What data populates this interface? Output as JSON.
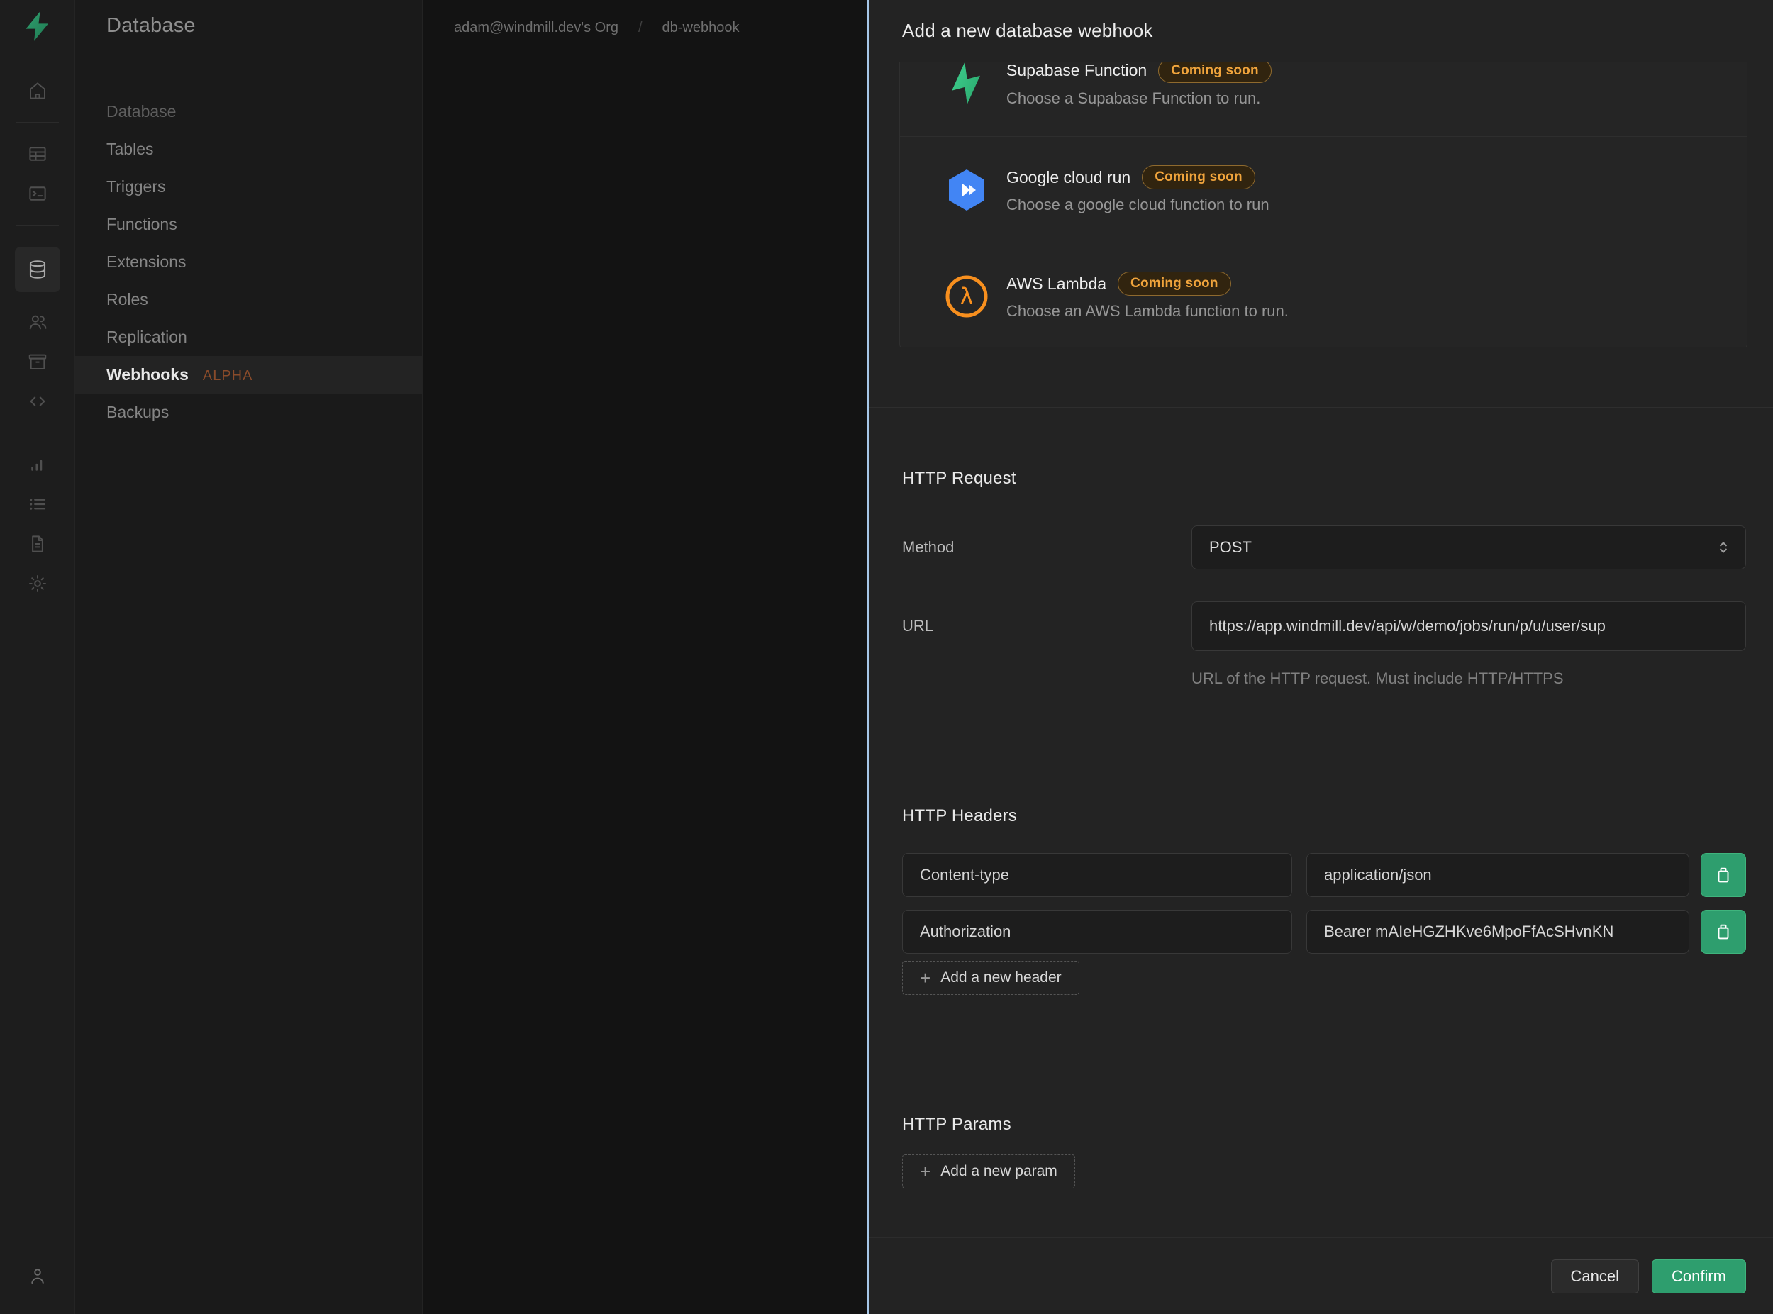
{
  "left": {
    "page_title": "Database",
    "breadcrumb": {
      "org": "adam@windmill.dev's Org",
      "separator": "/",
      "project": "db-webhook"
    }
  },
  "sidebar": {
    "section_title": "Database",
    "items": [
      "Tables",
      "Triggers",
      "Functions",
      "Extensions",
      "Roles",
      "Replication",
      "Webhooks",
      "Backups"
    ],
    "active_item": "Webhooks",
    "alpha_badge": "ALPHA"
  },
  "rail": {
    "icons": [
      "supabase-logo",
      "home",
      "table-editor",
      "sql-editor",
      "database",
      "auth-users",
      "storage",
      "edge-functions",
      "reports",
      "logs",
      "docs",
      "settings",
      "user"
    ]
  },
  "panel": {
    "title": "Add a new database webhook",
    "options": [
      {
        "name": "Supabase Function",
        "badge": "Coming soon",
        "description": "Choose a Supabase Function to run.",
        "icon": "supabase-bolt"
      },
      {
        "name": "Google cloud run",
        "badge": "Coming soon",
        "description": "Choose a google cloud function to run",
        "icon": "google-cloud-hexagon"
      },
      {
        "name": "AWS Lambda",
        "badge": "Coming soon",
        "description": "Choose an AWS Lambda function to run.",
        "icon": "aws-lambda-circle"
      }
    ],
    "http_request": {
      "title": "HTTP Request",
      "method_label": "Method",
      "method_value": "POST",
      "url_label": "URL",
      "url_value": "https://app.windmill.dev/api/w/demo/jobs/run/p/u/user/sup",
      "url_help": "URL of the HTTP request. Must include HTTP/HTTPS"
    },
    "http_headers": {
      "title": "HTTP Headers",
      "rows": [
        {
          "key": "Content-type",
          "value": "application/json"
        },
        {
          "key": "Authorization",
          "value": "Bearer mAIeHGZHKve6MpoFfAcSHvnKN"
        }
      ],
      "add_label": "Add a new header"
    },
    "http_params": {
      "title": "HTTP Params",
      "add_label": "Add a new param"
    },
    "footer": {
      "cancel": "Cancel",
      "confirm": "Confirm"
    }
  },
  "colors": {
    "accent_green": "#2e9e6e",
    "supabase_green": "#3ecf8e",
    "badge_amber": "#f0a43c",
    "divider_blue": "#a6c7e8",
    "gcp_blue": "#4285f4",
    "lambda_orange": "#f78f1e"
  }
}
